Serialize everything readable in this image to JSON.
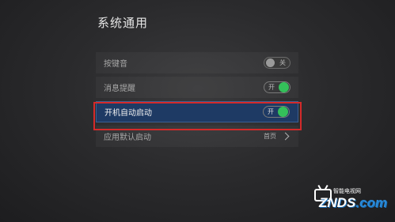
{
  "page": {
    "title": "系统通用"
  },
  "settings": [
    {
      "label": "按键音",
      "type": "toggle",
      "state": "off",
      "state_text": "关"
    },
    {
      "label": "消息提醒",
      "type": "toggle",
      "state": "on",
      "state_text": "开"
    },
    {
      "label": "开机自动启动",
      "type": "toggle",
      "state": "on",
      "state_text": "开",
      "selected": true
    },
    {
      "label": "应用默认启动",
      "type": "link",
      "value": "首页"
    }
  ],
  "watermark": {
    "cn": "智能电视网",
    "en_brand": "ZNDS",
    "en_suffix": ".com"
  },
  "colors": {
    "accent_green": "#34c05a",
    "selected_row": "#1e3a64",
    "highlight_border": "#d42a2a"
  }
}
